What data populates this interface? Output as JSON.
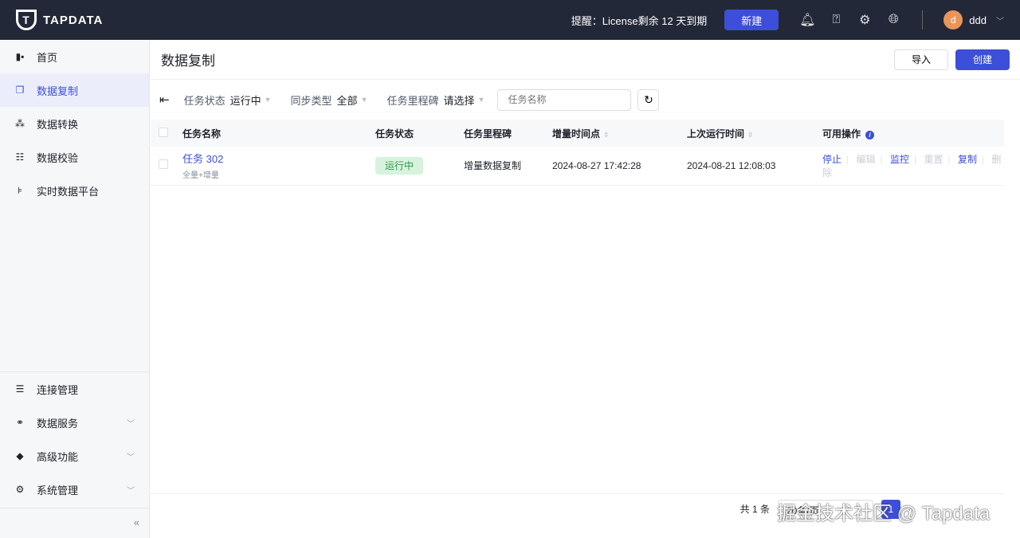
{
  "header": {
    "brand": "TAPDATA",
    "notice": "提醒：License剩余 12 天到期",
    "new_label": "新建",
    "user_initial": "d",
    "user_name": "ddd"
  },
  "sidebar": {
    "items": [
      {
        "label": "首页"
      },
      {
        "label": "数据复制",
        "active": true
      },
      {
        "label": "数据转换"
      },
      {
        "label": "数据校验"
      },
      {
        "label": "实时数据平台"
      }
    ],
    "bottom_items": [
      {
        "label": "连接管理"
      },
      {
        "label": "数据服务"
      },
      {
        "label": "高级功能"
      },
      {
        "label": "系统管理"
      }
    ],
    "collapse": "«"
  },
  "page": {
    "title": "数据复制",
    "import_label": "导入",
    "create_label": "创建"
  },
  "filters": {
    "status_label": "任务状态",
    "status_value": "运行中",
    "sync_label": "同步类型",
    "sync_value": "全部",
    "milestone_label": "任务里程碑",
    "milestone_value": "请选择",
    "search_placeholder": "任务名称"
  },
  "table": {
    "headers": [
      "任务名称",
      "任务状态",
      "任务里程碑",
      "增量时间点",
      "上次运行时间",
      "可用操作"
    ],
    "rows": [
      {
        "name": "任务 302",
        "type": "全量+增量",
        "status": "运行中",
        "milestone": "增量数据复制",
        "incr_time": "2024-08-27 17:42:28",
        "last_run": "2024-08-21 12:08:03",
        "actions": [
          {
            "label": "停止",
            "enabled": true
          },
          {
            "label": "编辑",
            "enabled": false
          },
          {
            "label": "监控",
            "enabled": true
          },
          {
            "label": "重置",
            "enabled": false
          },
          {
            "label": "复制",
            "enabled": true
          },
          {
            "label": "删除",
            "enabled": false
          }
        ]
      }
    ]
  },
  "pagination": {
    "total": "共 1 条",
    "page_size": "20条/页",
    "page": "1"
  },
  "watermark": "掘金技术社区 @ Tapdata",
  "colors": {
    "primary": "#3d4ed8",
    "topbar": "#222838",
    "running_bg": "#d7f3dd"
  }
}
